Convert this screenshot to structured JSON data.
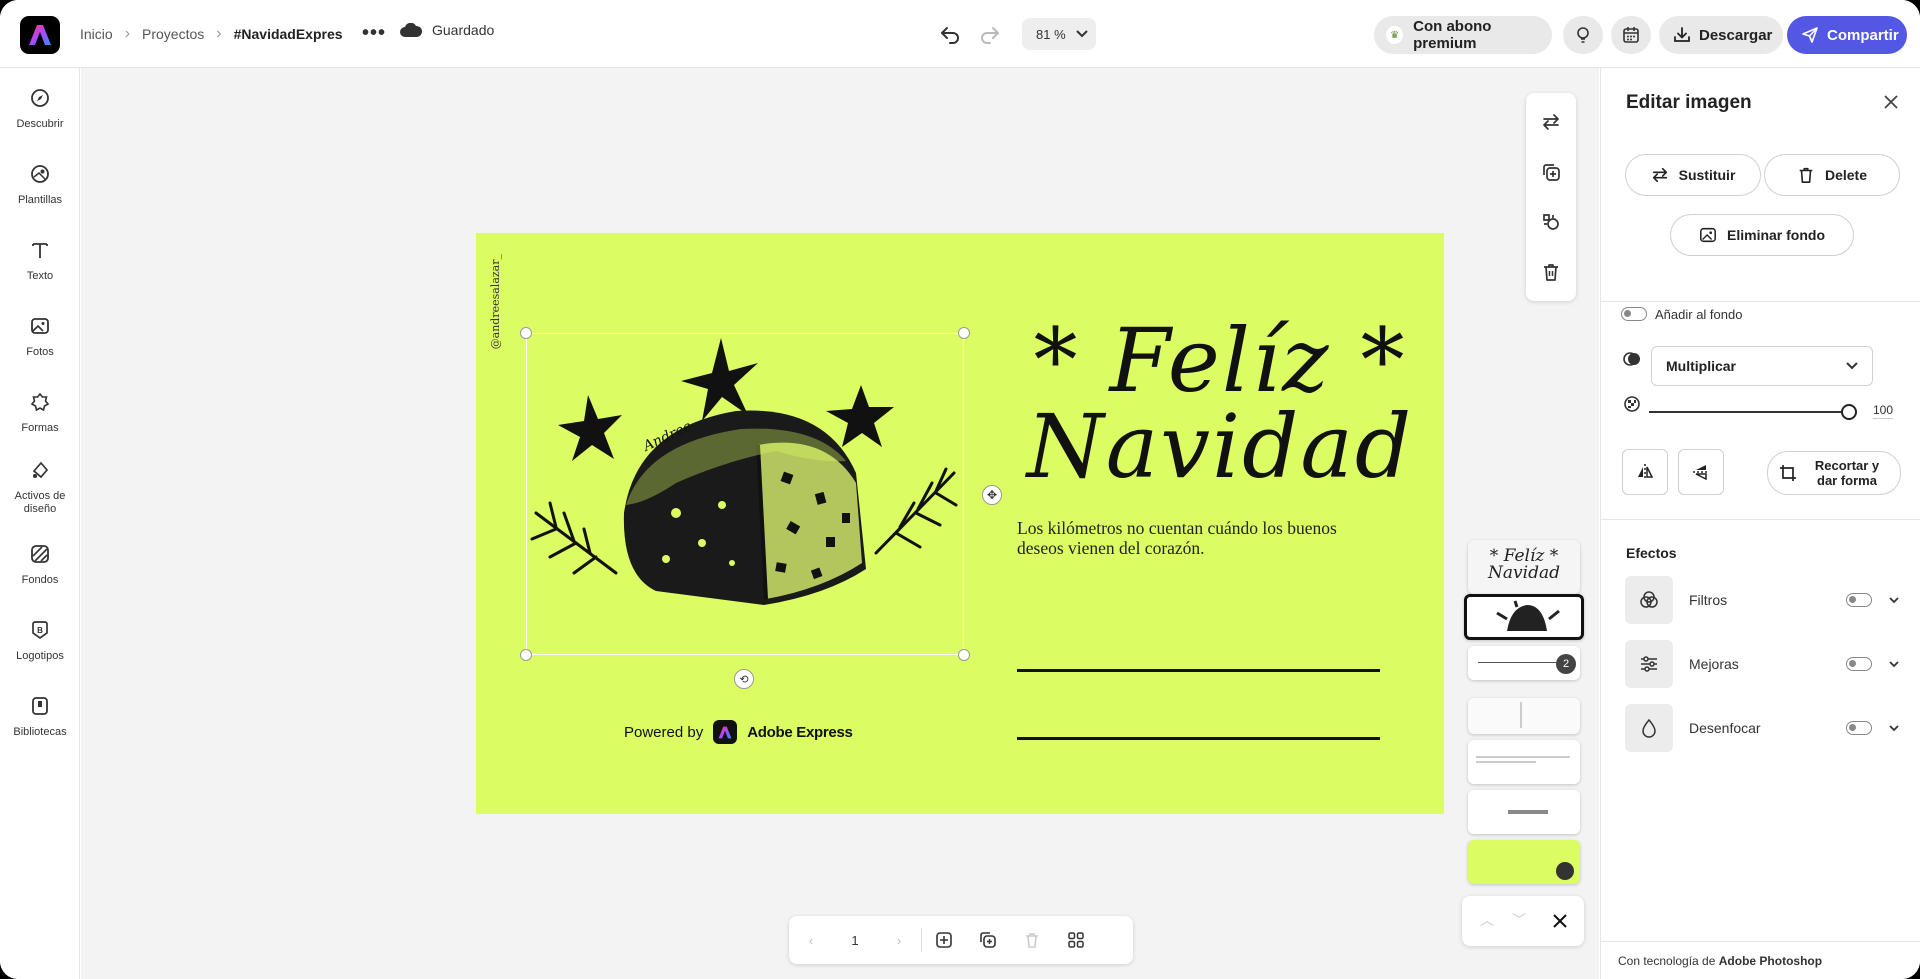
{
  "topbar": {
    "breadcrumbs": [
      "Inicio",
      "Proyectos",
      "#NavidadExpres"
    ],
    "saved_label": "Guardado",
    "zoom_value": "81 %",
    "premium_label": "Con abono premium",
    "download_label": "Descargar",
    "share_label": "Compartir",
    "share_color": "#5258e4"
  },
  "leftrail": {
    "items": [
      {
        "label": "Descubrir",
        "icon": "compass-icon"
      },
      {
        "label": "Plantillas",
        "icon": "templates-icon"
      },
      {
        "label": "Texto",
        "icon": "text-icon"
      },
      {
        "label": "Fotos",
        "icon": "photo-icon"
      },
      {
        "label": "Formas",
        "icon": "shapes-icon"
      },
      {
        "label": "Activos de diseño",
        "icon": "design-assets-icon"
      },
      {
        "label": "Fondos",
        "icon": "backgrounds-icon"
      },
      {
        "label": "Logotipos",
        "icon": "logo-icon"
      },
      {
        "label": "Bibliotecas",
        "icon": "libraries-icon"
      }
    ]
  },
  "card": {
    "background": "#dbfc62",
    "handle": "@andreesalazar_",
    "headline_line1": "* Felíz *",
    "headline_line2": "Navidad",
    "body": "Los kilómetros no cuentan cuándo los buenos deseos vienen del corazón.",
    "powered_prefix": "Powered by",
    "powered_brand": "Adobe Express",
    "image_signature": "Andree"
  },
  "thumbnails": {
    "badge_count": "2",
    "preview_line1": "* Felíz *",
    "preview_line2": "Navidad"
  },
  "pagebar": {
    "page_number": "1"
  },
  "panel": {
    "title": "Editar imagen",
    "replace_label": "Sustituir",
    "delete_label": "Delete",
    "remove_bg_label": "Eliminar fondo",
    "add_to_bg_label": "Añadir al fondo",
    "blend_mode": "Multiplicar",
    "opacity_value": "100",
    "opacity_fraction": 1.0,
    "crop_label": "Recortar y dar forma",
    "effects_title": "Efectos",
    "effects": [
      {
        "label": "Filtros",
        "icon": "filters-icon"
      },
      {
        "label": "Mejoras",
        "icon": "adjustments-icon"
      },
      {
        "label": "Desenfocar",
        "icon": "blur-icon"
      }
    ],
    "footer_prefix": "Con tecnología de",
    "footer_brand": "Adobe Photoshop"
  }
}
